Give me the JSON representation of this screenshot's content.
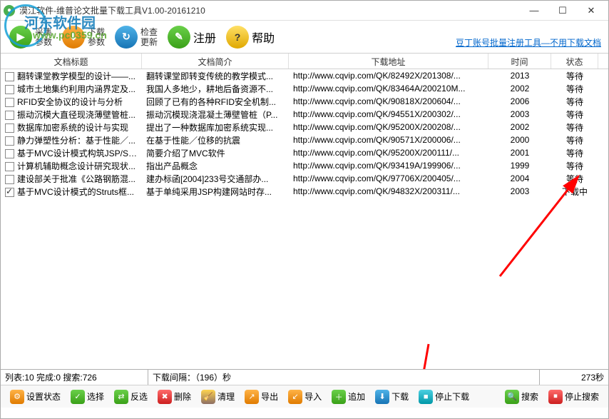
{
  "window": {
    "title": "漠江软件-维普论文批量下载工具V1.00-20161210"
  },
  "watermark": {
    "text": "河东软件园",
    "url": "www.pc0359.cn"
  },
  "toolbar": {
    "collect": {
      "l1": "采集",
      "l2": "参数"
    },
    "download": {
      "l1": "下载",
      "l2": "参数"
    },
    "check": {
      "l1": "检查",
      "l2": "更新"
    },
    "register": "注册",
    "help": "帮助",
    "link": "豆丁账号批量注册工具—不用下载文档"
  },
  "columns": {
    "title": "文档标题",
    "desc": "文档简介",
    "url": "下载地址",
    "time": "时间",
    "status": "状态"
  },
  "rows": [
    {
      "chk": false,
      "title": "翻转课堂教学模型的设计——...",
      "desc": "翻转课堂即转变传统的教学模式...",
      "url": "http://www.cqvip.com/QK/82492X/201308/...",
      "time": "2013",
      "status": "等待"
    },
    {
      "chk": false,
      "title": "城市土地集约利用内涵界定及...",
      "desc": "我国人多地少，耕地后备资源不...",
      "url": "http://www.cqvip.com/QK/83464A/200210M...",
      "time": "2002",
      "status": "等待"
    },
    {
      "chk": false,
      "title": "RFID安全协议的设计与分析",
      "desc": "回顾了已有的各种RFID安全机制...",
      "url": "http://www.cqvip.com/QK/90818X/200604/...",
      "time": "2006",
      "status": "等待"
    },
    {
      "chk": false,
      "title": "振动沉模大直径现浇薄壁管桩...",
      "desc": "振动沉模现浇混凝土薄壁管桩（P...",
      "url": "http://www.cqvip.com/QK/94551X/200302/...",
      "time": "2003",
      "status": "等待"
    },
    {
      "chk": false,
      "title": "数据库加密系统的设计与实现",
      "desc": "提出了一种数据库加密系统实现...",
      "url": "http://www.cqvip.com/QK/95200X/200208/...",
      "time": "2002",
      "status": "等待"
    },
    {
      "chk": false,
      "title": "静力弹塑性分析：基于性能／...",
      "desc": "在基于性能／位移的抗震",
      "url": "http://www.cqvip.com/QK/90571X/200006/...",
      "time": "2000",
      "status": "等待"
    },
    {
      "chk": false,
      "title": "基于MVC设计模式构筑JSP/Serv...",
      "desc": "简要介绍了MVC软件",
      "url": "http://www.cqvip.com/QK/95200X/200111/...",
      "time": "2001",
      "status": "等待"
    },
    {
      "chk": false,
      "title": "计算机辅助概念设计研究现状...",
      "desc": "指出产品概念",
      "url": "http://www.cqvip.com/QK/93419A/199906/...",
      "time": "1999",
      "status": "等待"
    },
    {
      "chk": false,
      "title": "建设部关于批准《公路钢筋混...",
      "desc": "建办标函[2004]233号交通部办...",
      "url": "http://www.cqvip.com/QK/97706X/200405/...",
      "time": "2004",
      "status": "等待"
    },
    {
      "chk": true,
      "title": "基于MVC设计模式的Struts框...",
      "desc": "基于单纯采用JSP构建网站时存...",
      "url": "http://www.cqvip.com/QK/94832X/200311/...",
      "time": "2003",
      "status": "下载中"
    }
  ],
  "statusbar": {
    "left": "列表:10 完成:0 搜索:726",
    "middle": "下载间隔：（196）秒",
    "right": "273秒"
  },
  "bottom": {
    "set_state": "设置状态",
    "select": "选择",
    "invert": "反选",
    "delete": "删除",
    "clear": "清理",
    "export": "导出",
    "import": "导入",
    "append": "追加",
    "download": "下载",
    "stop_download": "停止下载",
    "search": "搜索",
    "stop_search": "停止搜索"
  }
}
